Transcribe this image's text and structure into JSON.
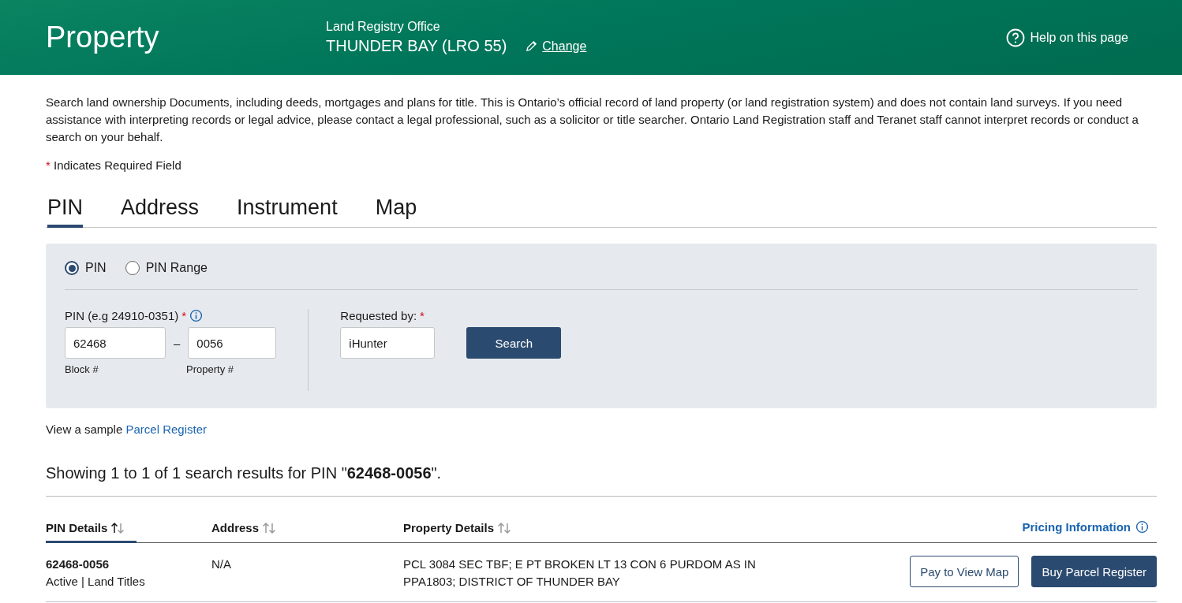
{
  "header": {
    "title": "Property",
    "office_label": "Land Registry Office",
    "office_name": "THUNDER BAY (LRO 55)",
    "change_link": "Change",
    "help_link": "Help on this page"
  },
  "intro": "Search land ownership Documents, including deeds, mortgages and plans for title. This is Ontario’s official record of land property (or land registration system) and does not contain land surveys. If you need assistance with interpreting records or legal advice, please contact a legal professional, such as a solicitor or title searcher. Ontario Land Registration staff and Teranet staff cannot interpret records or conduct a search on your behalf.",
  "required_note": {
    "mark": "*",
    "text": "Indicates Required Field"
  },
  "tabs": [
    {
      "label": "PIN",
      "selected": true
    },
    {
      "label": "Address",
      "selected": false
    },
    {
      "label": "Instrument",
      "selected": false
    },
    {
      "label": "Map",
      "selected": false
    }
  ],
  "search_form": {
    "modes": [
      {
        "label": "PIN",
        "selected": true
      },
      {
        "label": "PIN Range",
        "selected": false
      }
    ],
    "pin_label": "PIN (e.g 24910-0351)",
    "pin_required": "*",
    "block_value": "62468",
    "separator": "–",
    "property_value": "0056",
    "block_caption": "Block #",
    "property_caption": "Property #",
    "requested_label": "Requested by:",
    "requested_required": "*",
    "requested_value": "iHunter",
    "search_button": "Search"
  },
  "sample": {
    "text": "View a sample",
    "link": "Parcel Register"
  },
  "results_summary": "Showing 1 to 1 of 1 search results for PIN \"**62468-0056**\".",
  "table": {
    "columns": [
      {
        "label": "PIN Details",
        "sorted": true
      },
      {
        "label": "Address",
        "sorted": false
      },
      {
        "label": "Property Details",
        "sorted": false
      }
    ],
    "pricing_link": "Pricing Information",
    "rows": [
      {
        "pin": "62468-0056",
        "status": "Active | Land Titles",
        "address": "N/A",
        "property_details": "PCL 3084 SEC TBF; E PT BROKEN LT 13 CON 6 PURDOM AS IN PPA1803; DISTRICT OF THUNDER BAY",
        "actions": [
          "Pay to View Map",
          "Buy Parcel Register"
        ]
      }
    ]
  }
}
